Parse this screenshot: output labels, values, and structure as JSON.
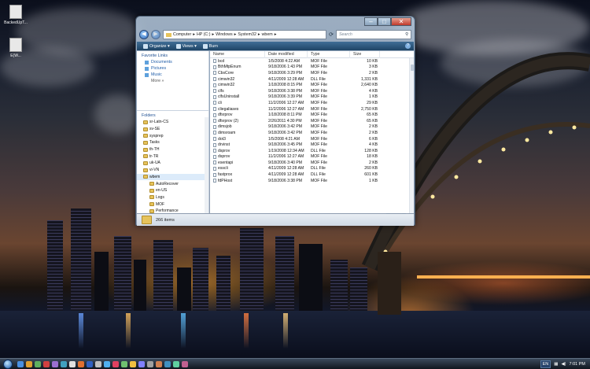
{
  "desktop": {
    "icons": [
      {
        "label": "BackedUpT...",
        "icon": "folder-icon"
      },
      {
        "label": "E(W..."
      }
    ]
  },
  "window": {
    "caption_buttons": {
      "minimize": "–",
      "maximize": "□",
      "close": "✕"
    },
    "address": {
      "crumbs": [
        "Computer",
        "HP (C:)",
        "Windows",
        "System32",
        "wbem"
      ],
      "separator": "▸"
    },
    "search": {
      "placeholder": "Search"
    },
    "toolbar": {
      "organize": "Organize ▾",
      "views": "Views ▾",
      "burn": "Burn"
    },
    "favorite_links": {
      "heading": "Favorite Links",
      "items": [
        "Documents",
        "Pictures",
        "Music"
      ],
      "more": "More »"
    },
    "folders": {
      "heading": "Folders",
      "items": [
        {
          "label": "sr-Latn-CS",
          "indent": 1
        },
        {
          "label": "sv-SE",
          "indent": 1
        },
        {
          "label": "sysprep",
          "indent": 1
        },
        {
          "label": "Tasks",
          "indent": 1
        },
        {
          "label": "th-TH",
          "indent": 1
        },
        {
          "label": "tr-TR",
          "indent": 1
        },
        {
          "label": "uk-UA",
          "indent": 1
        },
        {
          "label": "vi-VN",
          "indent": 1
        },
        {
          "label": "wbem",
          "indent": 1,
          "selected": true
        },
        {
          "label": "AutoRecover",
          "indent": 2
        },
        {
          "label": "en-US",
          "indent": 2
        },
        {
          "label": "Logs",
          "indent": 2
        },
        {
          "label": "MOF",
          "indent": 2
        },
        {
          "label": "Performance",
          "indent": 2
        },
        {
          "label": "repository",
          "indent": 2
        }
      ]
    },
    "columns": [
      "Name",
      "Date modified",
      "Type",
      "Size"
    ],
    "files": [
      [
        "bcd",
        "1/5/2008 4:22 AM",
        "MOF File",
        "10 KB"
      ],
      [
        "BthMtpEnum",
        "9/18/2006 1:43 PM",
        "MOF File",
        "3 KB"
      ],
      [
        "CbsCore",
        "9/18/2006 3:29 PM",
        "MOF File",
        "2 KB"
      ],
      [
        "cimwin32",
        "4/11/2009 12:28 AM",
        "DLL File",
        "1,331 KB"
      ],
      [
        "cimwin32",
        "1/18/2008 8:15 PM",
        "MOF File",
        "2,640 KB"
      ],
      [
        "clfs",
        "9/18/2006 3:38 PM",
        "MOF File",
        "4 KB"
      ],
      [
        "clfsUninstall",
        "9/18/2006 3:39 PM",
        "MOF File",
        "1 KB"
      ],
      [
        "cli",
        "11/2/2006 12:27 AM",
        "MOF File",
        "29 KB"
      ],
      [
        "cliegaliases",
        "11/2/2006 12:27 AM",
        "MOF File",
        "2,750 KB"
      ],
      [
        "dfsrprov",
        "1/18/2008 8:11 PM",
        "MOF File",
        "65 KB"
      ],
      [
        "dfsrprov (2)",
        "2/26/2011 4:30 PM",
        "MOF File",
        "65 KB"
      ],
      [
        "dimsjob",
        "9/18/2006 3:42 PM",
        "MOF File",
        "2 KB"
      ],
      [
        "dimsroam",
        "9/18/2006 3:42 PM",
        "MOF File",
        "2 KB"
      ],
      [
        "dot3",
        "1/5/2008 4:21 AM",
        "MOF File",
        "6 KB"
      ],
      [
        "drvinst",
        "9/18/2006 3:45 PM",
        "MOF File",
        "4 KB"
      ],
      [
        "dsprov",
        "1/19/2008 12:34 AM",
        "DLL File",
        "128 KB"
      ],
      [
        "dsprov",
        "11/2/2006 12:27 AM",
        "MOF File",
        "18 KB"
      ],
      [
        "esentapi",
        "9/18/2006 3:40 PM",
        "MOF File",
        "2 KB"
      ],
      [
        "esscli",
        "4/11/2009 12:28 AM",
        "DLL File",
        "260 KB"
      ],
      [
        "fastprox",
        "4/11/2009 12:28 AM",
        "DLL File",
        "601 KB"
      ],
      [
        "fdPHost",
        "9/18/2006 3:38 PM",
        "MOF File",
        "1 KB"
      ]
    ],
    "details": {
      "count": "266 items"
    }
  },
  "taskbar": {
    "quick_launch": [
      "#4a90e2",
      "#e0a030",
      "#5fb05f",
      "#d04040",
      "#9a6fd0",
      "#40a0c0",
      "#e0e0e0",
      "#e07030",
      "#3060c0",
      "#c0c0c0",
      "#50b0f0",
      "#e04060",
      "#70c070",
      "#f0c040",
      "#8080ff",
      "#a0a0a0",
      "#d08050",
      "#4090c0",
      "#60d0a0",
      "#c06090"
    ],
    "language": "EN",
    "clock": "7:01 PM"
  }
}
